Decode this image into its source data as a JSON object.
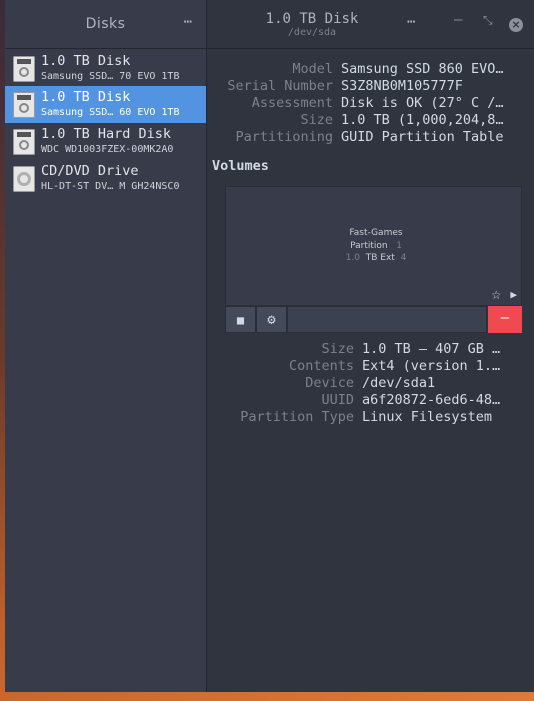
{
  "sidebar": {
    "title": "Disks",
    "menu_icon": "⋯",
    "items": [
      {
        "name": "1.0 TB Disk",
        "subtitle": "Samsung SSD… 70 EVO 1TB",
        "icon": "hard-disk-icon"
      },
      {
        "name": "1.0 TB Disk",
        "subtitle": "Samsung SSD… 60 EVO 1TB",
        "icon": "hard-disk-icon",
        "selected": true
      },
      {
        "name": "1.0 TB Hard Disk",
        "subtitle": "WDC WD1003FZEX-00MK2A0",
        "icon": "hard-disk-icon"
      },
      {
        "name": "CD/DVD Drive",
        "subtitle": "HL-DT-ST DV… M GH24NSC0",
        "icon": "optical-drive-icon"
      }
    ]
  },
  "header": {
    "title": "1.0 TB Disk",
    "subtitle": "/dev/sda",
    "menu_icon": "⋯",
    "minimize": "–",
    "maximize": "⤡",
    "close": "×"
  },
  "disk_properties": [
    {
      "label": "Model",
      "value": "Samsung SSD 860 EVO…"
    },
    {
      "label": "Serial Number",
      "value": "S3Z8NB0M105777F"
    },
    {
      "label": "Assessment",
      "value": "Disk is OK (27° C /…"
    },
    {
      "label": "Size",
      "value": "1.0 TB (1,000,204,8…"
    },
    {
      "label": "Partitioning",
      "value": "GUID Partition Table"
    }
  ],
  "volumes": {
    "title": "Volumes",
    "partition": {
      "name": "Fast-Games",
      "type": "Partition",
      "mark": "1",
      "size_prefix": "1.0",
      "size": "TB Ext",
      "size_suffix": "4"
    },
    "toolbar": {
      "stop": "■",
      "settings": "⚙",
      "delete": "—"
    }
  },
  "volume_properties": [
    {
      "label": "Size",
      "value": "1.0 TB — 407 GB …"
    },
    {
      "label": "Contents",
      "value": "Ext4 (version 1.…"
    },
    {
      "label": "Device",
      "value": "/dev/sda1"
    },
    {
      "label": "UUID",
      "value": "a6f20872-6ed6-48…"
    },
    {
      "label": "Partition Type",
      "value": "Linux Filesystem"
    }
  ],
  "colors": {
    "selection": "#5294e2",
    "delete": "#f04a50",
    "background": "#2f343f",
    "sidebar": "#383c4a"
  }
}
